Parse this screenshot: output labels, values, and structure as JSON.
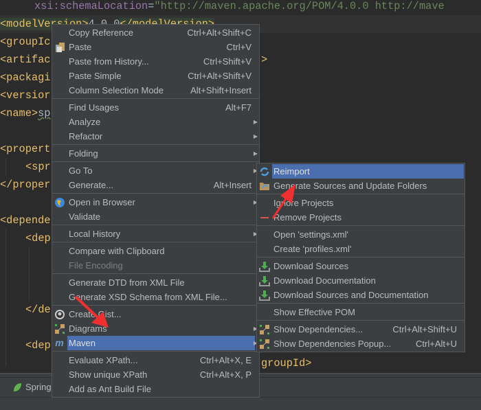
{
  "editor": {
    "line1": {
      "attr": "xsi:schemaLocation",
      "eq": "=",
      "value": "\"http://maven.apache.org/POM/4.0.0 http://mave"
    },
    "modelVersion": {
      "open": "<modelVersion>",
      "text": "4.0.0",
      "close": "</modelVersion>"
    },
    "fragments": [
      "<groupIc",
      "<artifac",
      "<packagi",
      "<versior",
      "<name>",
      "sp",
      "<propert",
      "<spr",
      "</proper",
      "<depende",
      "<dep",
      "</de",
      "<dep"
    ],
    "right_fragments": [
      ">",
      "groupId>"
    ]
  },
  "main_menu": [
    {
      "label": "Copy Reference",
      "shortcut": "Ctrl+Alt+Shift+C"
    },
    {
      "label": "Paste",
      "shortcut": "Ctrl+V",
      "icon": "clipboard-icon"
    },
    {
      "label": "Paste from History...",
      "shortcut": "Ctrl+Shift+V"
    },
    {
      "label": "Paste Simple",
      "shortcut": "Ctrl+Alt+Shift+V"
    },
    {
      "label": "Column Selection Mode",
      "shortcut": "Alt+Shift+Insert"
    },
    {
      "label": "Find Usages",
      "shortcut": "Alt+F7"
    },
    {
      "label": "Analyze",
      "submenu": true
    },
    {
      "label": "Refactor",
      "submenu": true
    },
    {
      "label": "Folding",
      "submenu": true
    },
    {
      "label": "Go To",
      "submenu": true
    },
    {
      "label": "Generate...",
      "shortcut": "Alt+Insert"
    },
    {
      "label": "Open in Browser",
      "submenu": true,
      "icon": "globe-icon"
    },
    {
      "label": "Validate"
    },
    {
      "label": "Local History",
      "submenu": true
    },
    {
      "label": "Compare with Clipboard"
    },
    {
      "label": "File Encoding",
      "disabled": true
    },
    {
      "label": "Generate DTD from XML File"
    },
    {
      "label": "Generate XSD Schema from XML File..."
    },
    {
      "label": "Create Gist...",
      "icon": "github-icon"
    },
    {
      "label": "Diagrams",
      "submenu": true,
      "icon": "diagram-icon"
    },
    {
      "label": "Maven",
      "submenu": true,
      "icon": "maven-icon",
      "selected": true
    },
    {
      "label": "Evaluate XPath...",
      "shortcut": "Ctrl+Alt+X, E"
    },
    {
      "label": "Show unique XPath",
      "shortcut": "Ctrl+Alt+X, P"
    },
    {
      "label": "Add as Ant Build File"
    }
  ],
  "maven_menu": [
    {
      "label": "Reimport",
      "icon": "reimport-icon",
      "selected": true
    },
    {
      "label": "Generate Sources and Update Folders",
      "icon": "folder-refresh-icon"
    },
    {
      "label": "Ignore Projects"
    },
    {
      "label": "Remove Projects",
      "icon": "minus-icon"
    },
    {
      "label": "Open 'settings.xml'"
    },
    {
      "label": "Create 'profiles.xml'"
    },
    {
      "label": "Download Sources",
      "icon": "download-icon"
    },
    {
      "label": "Download Documentation",
      "icon": "download-icon"
    },
    {
      "label": "Download Sources and Documentation",
      "icon": "download-icon"
    },
    {
      "label": "Show Effective POM"
    },
    {
      "label": "Show Dependencies...",
      "shortcut": "Ctrl+Alt+Shift+U",
      "icon": "diagram-icon"
    },
    {
      "label": "Show Dependencies Popup...",
      "shortcut": "Ctrl+Alt+U",
      "icon": "diagram-icon"
    }
  ],
  "toolwindow": {
    "spring_tab": "Spring"
  },
  "colors": {
    "selection": "#4b6eaf",
    "menu_bg": "#3c3f41",
    "editor_bg": "#2b2b2b",
    "tag": "#e8bf6a",
    "annotation_arrow": "#f03030"
  }
}
